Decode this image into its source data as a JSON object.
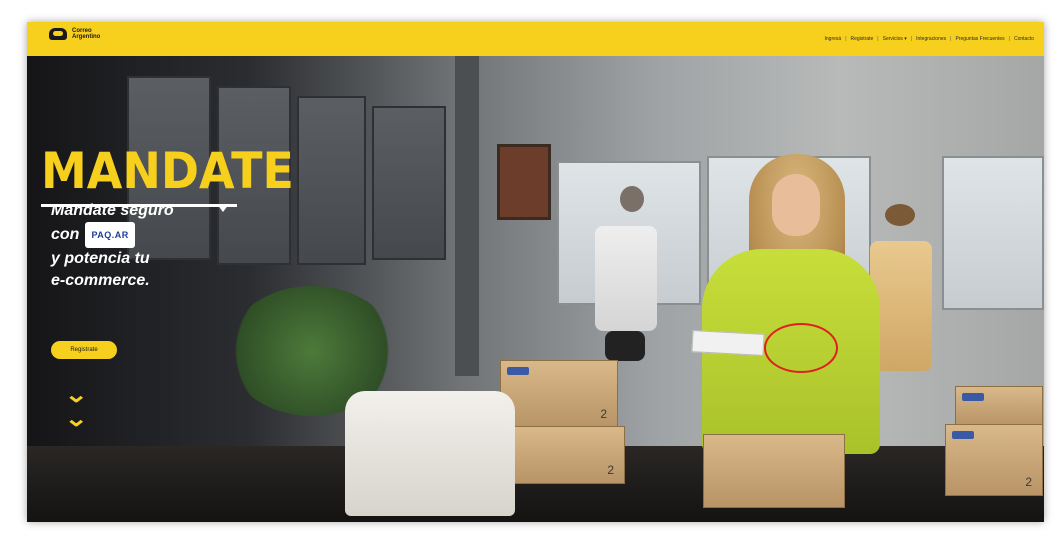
{
  "header": {
    "logo_text": "Correo Argentino",
    "nav": [
      "Ingresá",
      "Registrate",
      "Servicios",
      "Integraciones",
      "Preguntas Frecuentes",
      "Contacto"
    ]
  },
  "hero": {
    "brand_title": "MANDATE",
    "tagline": {
      "line1": "Mandate seguro",
      "line2_prefix": "con",
      "badge": "PAQ.AR",
      "line3": "y potencia tu",
      "line4": "e-commerce."
    },
    "cta_label": "Registrate",
    "box_numbers": [
      "2",
      "2",
      "2"
    ]
  },
  "colors": {
    "brand_yellow": "#f7cf1d",
    "annotation_red": "#e02020",
    "badge_blue": "#1d3f97"
  },
  "icons": [
    "correo-logo-icon",
    "chevron-down-icon"
  ]
}
